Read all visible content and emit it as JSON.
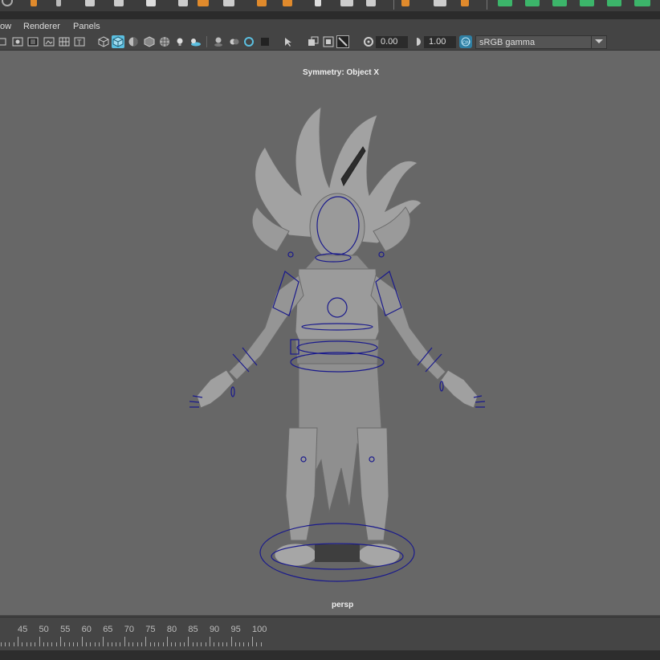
{
  "menubar": {
    "items": [
      "ow",
      "Renderer",
      "Panels"
    ]
  },
  "toolbar": {
    "exposure_value": "0.00",
    "gamma_value": "1.00",
    "color_space": "sRGB gamma",
    "icons": [
      "camera-select-icon",
      "camera-attr-icon",
      "bookmark-icon",
      "image-plane-icon",
      "grid-icon",
      "film-gate-icon",
      "resolution-gate-icon",
      "gate-mask-icon",
      "field-chart-icon",
      "safe-action-icon",
      "safe-title-icon",
      "wireframe-icon",
      "smooth-shade-icon",
      "default-material-icon",
      "shaded-wireframe-icon",
      "textured-icon",
      "lights-icon",
      "shadows-icon",
      "screen-ao-icon",
      "motion-blur-icon",
      "anti-alias-icon",
      "depth-of-field-icon",
      "isolate-select-icon",
      "xray-icon",
      "xray-joints-icon",
      "xray-active-icon",
      "exposure-icon",
      "gamma-icon",
      "color-management-icon"
    ]
  },
  "viewport": {
    "symmetry_label": "Symmetry: Object X",
    "camera_label": "persp"
  },
  "timeline": {
    "ticks": [
      "45",
      "50",
      "55",
      "60",
      "65",
      "70",
      "75",
      "80",
      "85",
      "90",
      "95",
      "100"
    ]
  },
  "colors": {
    "viewport_bg": "#676767",
    "accent_blue": "#5bbfe0",
    "controller_blue": "#1a1a8c",
    "ui_bg": "#444444"
  }
}
